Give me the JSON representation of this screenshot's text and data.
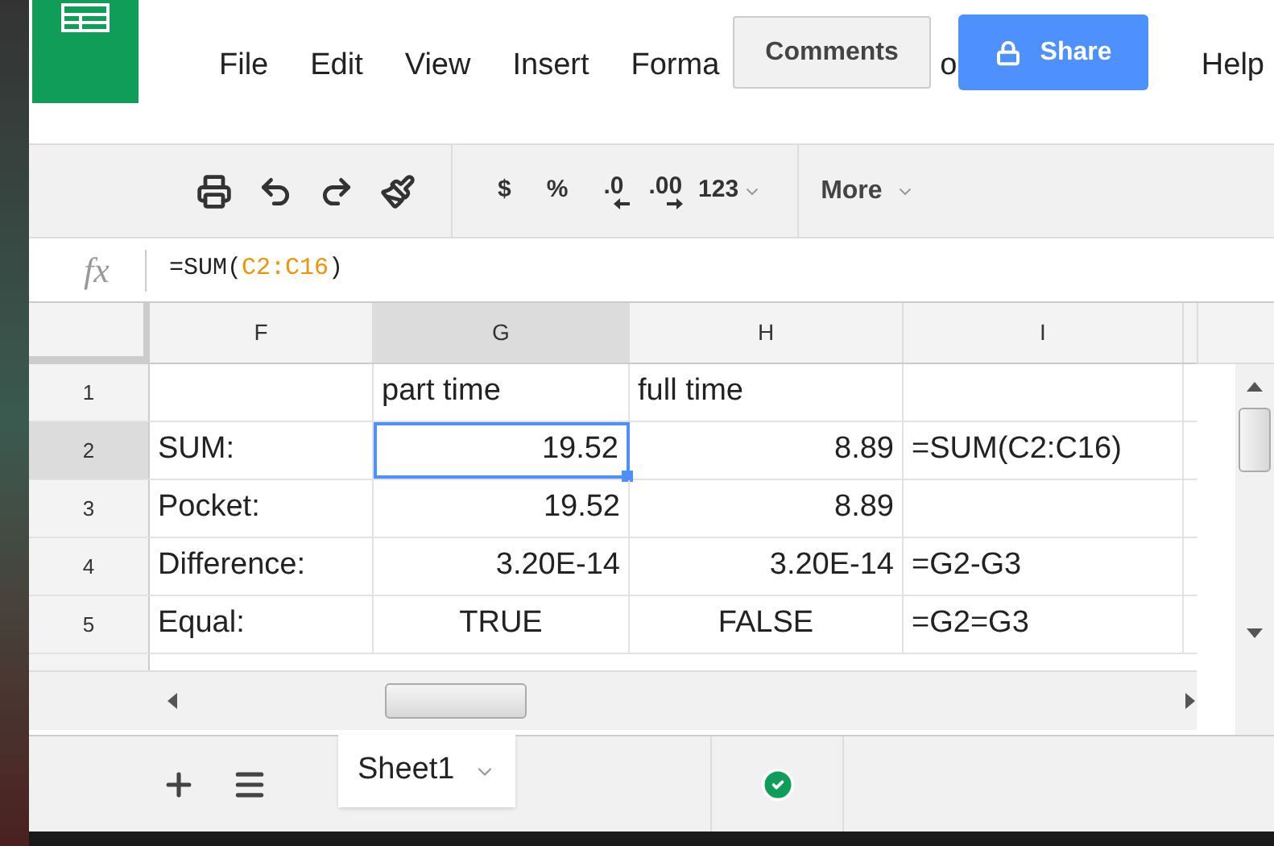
{
  "menu": [
    {
      "label": "File"
    },
    {
      "label": "Edit"
    },
    {
      "label": "View"
    },
    {
      "label": "Insert"
    },
    {
      "label": "Forma"
    },
    {
      "label": "o"
    },
    {
      "label": "Help"
    }
  ],
  "comments_button": "Comments",
  "share_button": "Share",
  "toolbar": {
    "currency": "$",
    "percent": "%",
    "decrease_decimals": ".0",
    "increase_decimals": ".00",
    "number_format": "123",
    "more": "More"
  },
  "formula_bar": {
    "label": "fx",
    "prefix": "=SUM(",
    "range": "C2:C16",
    "suffix": ")"
  },
  "columns": [
    {
      "label": "F",
      "selected": false
    },
    {
      "label": "G",
      "selected": true
    },
    {
      "label": "H",
      "selected": false
    },
    {
      "label": "I",
      "selected": false
    }
  ],
  "rows": [
    {
      "number": "1",
      "selected": false,
      "cells": [
        {
          "text": "",
          "kind": "text",
          "selected": false
        },
        {
          "text": "part time",
          "kind": "text",
          "selected": false
        },
        {
          "text": "full time",
          "kind": "text",
          "selected": false
        },
        {
          "text": "",
          "kind": "text",
          "selected": false
        }
      ]
    },
    {
      "number": "2",
      "selected": true,
      "cells": [
        {
          "text": "SUM:",
          "kind": "text",
          "selected": false
        },
        {
          "text": "19.52",
          "kind": "number",
          "selected": true
        },
        {
          "text": "8.89",
          "kind": "number",
          "selected": false
        },
        {
          "text": "=SUM(C2:C16)",
          "kind": "text",
          "selected": false
        }
      ]
    },
    {
      "number": "3",
      "selected": false,
      "cells": [
        {
          "text": "Pocket:",
          "kind": "text",
          "selected": false
        },
        {
          "text": "19.52",
          "kind": "number",
          "selected": false
        },
        {
          "text": "8.89",
          "kind": "number",
          "selected": false
        },
        {
          "text": "",
          "kind": "text",
          "selected": false
        }
      ]
    },
    {
      "number": "4",
      "selected": false,
      "cells": [
        {
          "text": "Difference:",
          "kind": "text",
          "selected": false
        },
        {
          "text": "3.20E-14",
          "kind": "number",
          "selected": false
        },
        {
          "text": "3.20E-14",
          "kind": "number",
          "selected": false
        },
        {
          "text": "=G2-G3",
          "kind": "text",
          "selected": false
        }
      ]
    },
    {
      "number": "5",
      "selected": false,
      "cells": [
        {
          "text": "Equal:",
          "kind": "text",
          "selected": false
        },
        {
          "text": "TRUE",
          "kind": "boolean",
          "selected": false
        },
        {
          "text": "FALSE",
          "kind": "boolean",
          "selected": false
        },
        {
          "text": "=G2=G3",
          "kind": "text",
          "selected": false
        }
      ]
    }
  ],
  "sheet_tabs": [
    {
      "label": "Sheet1",
      "selected": true
    }
  ]
}
